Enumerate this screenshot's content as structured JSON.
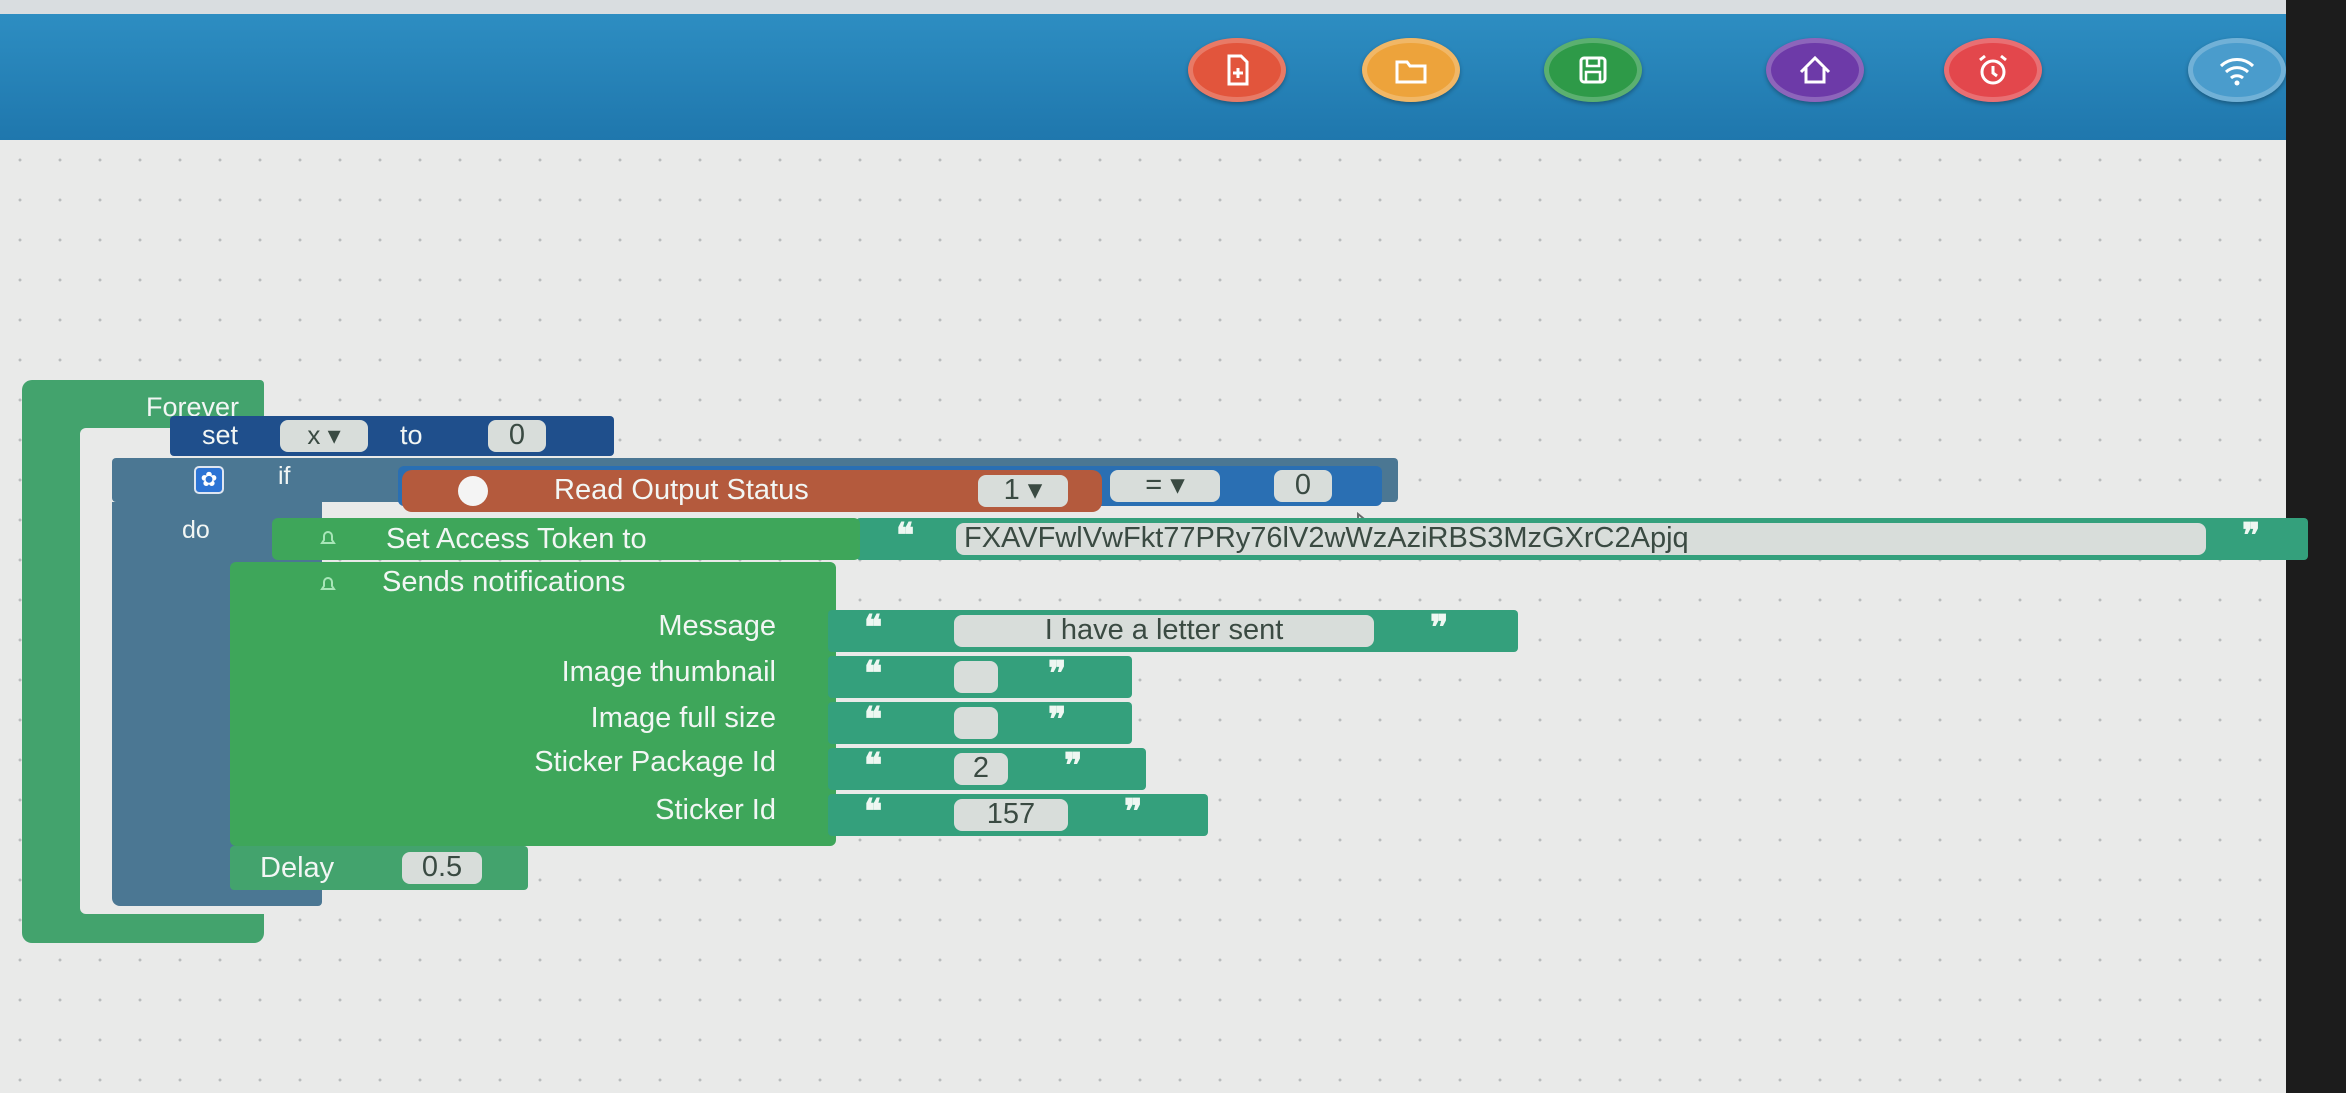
{
  "header": {
    "buttons": [
      {
        "name": "new-file-button",
        "icon": "new-file-icon",
        "color": "#e2553c"
      },
      {
        "name": "open-folder-button",
        "icon": "folder-icon",
        "color": "#eda33b"
      },
      {
        "name": "save-button",
        "icon": "save-icon",
        "color": "#2e9a48"
      },
      {
        "name": "home-button",
        "icon": "home-icon",
        "color": "#6d3aa8"
      },
      {
        "name": "alarm-button",
        "icon": "alarm-clock-icon",
        "color": "#e3474c"
      },
      {
        "name": "wifi-button",
        "icon": "wifi-icon",
        "color": "#4a9ccc"
      }
    ]
  },
  "blocks": {
    "forever": {
      "label": "Forever",
      "color": "#43a36d"
    },
    "set_var": {
      "set_label": "set",
      "var": "x",
      "to_label": "to",
      "value": "0",
      "color": "#1f4f8c"
    },
    "if_block": {
      "if_label": "if",
      "do_label": "do",
      "color": "#4b7793"
    },
    "read_output": {
      "label": "Read Output Status",
      "channel": "1",
      "color": "#b45a3d"
    },
    "compare": {
      "operator": "=",
      "value": "0",
      "color": "#2a6fb3"
    },
    "set_token": {
      "label": "Set Access Token to",
      "token": "FXAVFwlVwFkt77PRy76lV2wWzAziRBS3MzGXrC2Apjq",
      "color": "#3ea65a"
    },
    "notify": {
      "title": "Sends notifications",
      "fields": [
        {
          "label": "Message",
          "value": "I have a letter sent"
        },
        {
          "label": "Image thumbnail",
          "value": ""
        },
        {
          "label": "Image full size",
          "value": ""
        },
        {
          "label": "Sticker Package Id",
          "value": "2"
        },
        {
          "label": "Sticker Id",
          "value": "157"
        }
      ],
      "color": "#3ea65a",
      "string_color": "#34a07c"
    },
    "delay": {
      "label": "Delay",
      "value": "0.5",
      "color": "#43a36d"
    }
  }
}
